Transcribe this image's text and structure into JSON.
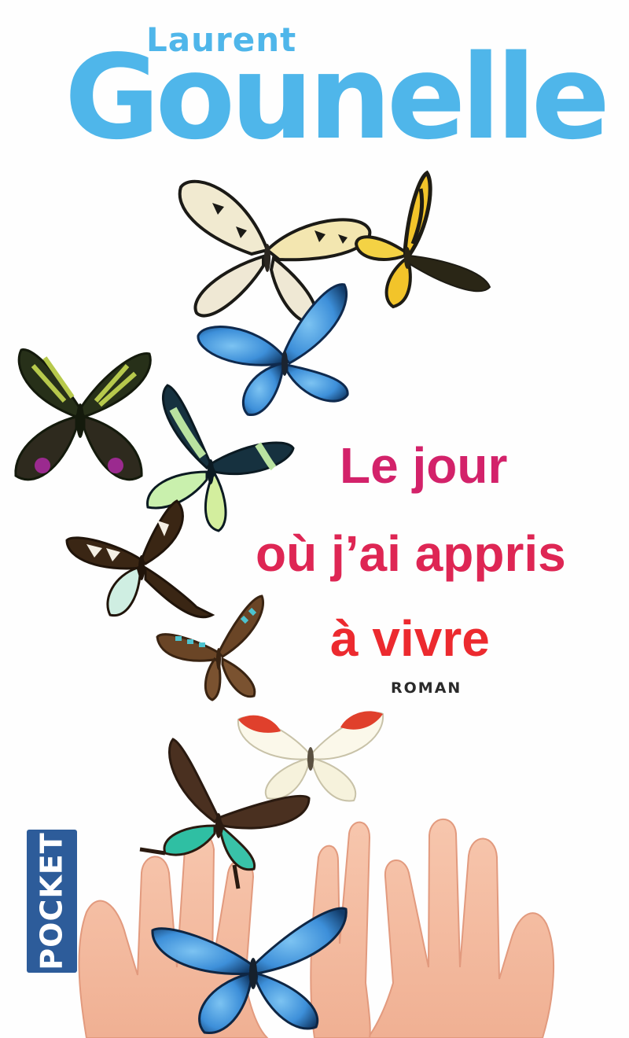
{
  "cover": {
    "author_first": "Laurent",
    "author_last": "Gounelle",
    "title_lines": [
      "Le jour",
      "où j’ai appris",
      "à vivre"
    ],
    "genre": "ROMAN",
    "publisher": "POCKET"
  },
  "colors": {
    "author": "#4fb6ea",
    "title_start": "#d3226a",
    "title_end": "#ec2a2f",
    "publisher_bg": "#2d5c9a",
    "hand": "#f6c1a6"
  },
  "illustration": {
    "butterflies": [
      {
        "name": "paper-kite-butterfly",
        "colors": [
          "#f2ecd2",
          "#1b1a16"
        ]
      },
      {
        "name": "yellow-swallowtail-butterfly",
        "colors": [
          "#f2c42a",
          "#1e1c14"
        ]
      },
      {
        "name": "blue-morpho-butterfly",
        "colors": [
          "#3d91d8",
          "#0f2a4e"
        ]
      },
      {
        "name": "green-black-moth",
        "colors": [
          "#273019",
          "#b7c94c"
        ]
      },
      {
        "name": "turquoise-swallowtail-butterfly",
        "colors": [
          "#16313f",
          "#b9e2a0"
        ]
      },
      {
        "name": "brown-white-swallowtail-butterfly",
        "colors": [
          "#3a2614",
          "#f4efe4"
        ]
      },
      {
        "name": "teal-spotted-butterfly",
        "colors": [
          "#6a4526",
          "#4dc3cf"
        ]
      },
      {
        "name": "orange-tip-white-butterfly",
        "colors": [
          "#fbf8ea",
          "#e0402c"
        ]
      },
      {
        "name": "brown-green-swallowtail-butterfly",
        "colors": [
          "#4a3020",
          "#2fbfa3"
        ]
      },
      {
        "name": "blue-morpho-on-hands-butterfly",
        "colors": [
          "#3a8cd8",
          "#0e2644"
        ]
      }
    ]
  }
}
